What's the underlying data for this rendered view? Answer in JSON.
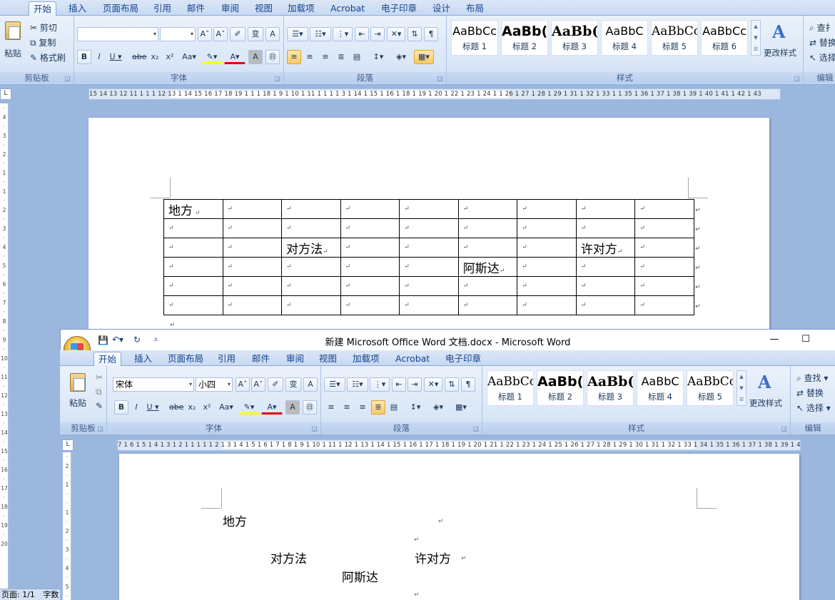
{
  "back_window": {
    "tabs": [
      "开始",
      "插入",
      "页面布局",
      "引用",
      "邮件",
      "审阅",
      "视图",
      "加载项",
      "Acrobat",
      "电子印章",
      "设计",
      "布局"
    ],
    "clipboard": {
      "paste": "粘贴",
      "cut": "剪切",
      "copy": "复制",
      "format_painter": "格式刷",
      "label": "剪贴板"
    },
    "font_label": "字体",
    "paragraph_label": "段落",
    "styles": [
      {
        "sample": "AaBbCc",
        "name": "标题 1"
      },
      {
        "sample": "AaBb(",
        "name": "标题 2"
      },
      {
        "sample": "AaBb(",
        "name": "标题 3"
      },
      {
        "sample": "AaBbC",
        "name": "标题 4"
      },
      {
        "sample": "AaBbCc",
        "name": "标题 5"
      },
      {
        "sample": "AaBbCc",
        "name": "标题 6"
      }
    ],
    "change_styles": "更改样式",
    "styles_label": "样式",
    "editing": {
      "find": "查扌",
      "replace": "替换",
      "select": "选择",
      "label": "编辑"
    },
    "ruler_text": "15 14 13 12 11 1 1 1 12 13 1 14 15 16 17 18 19 1 1 1 18 1 9 1 10 1 11 1 1 1 1 3 1 14 1 15 1 16 1 18 1 19 1 20 1 22 1 23 1 24 1 1 26 1 27 1 28 1 29 1 31 1 32 1 33 1 1 35 1 36 1 37 1 38 1 39 1 40 1 41 1 42 1 43",
    "table": [
      [
        "地方",
        "",
        "",
        "",
        "",
        "",
        "",
        "",
        ""
      ],
      [
        "",
        "",
        "",
        "",
        "",
        "",
        "",
        "",
        ""
      ],
      [
        "",
        "",
        "对方法",
        "",
        "",
        "",
        "",
        "许对方",
        ""
      ],
      [
        "",
        "",
        "",
        "",
        "",
        "阿斯达",
        "",
        "",
        ""
      ],
      [
        "",
        "",
        "",
        "",
        "",
        "",
        "",
        "",
        ""
      ],
      [
        "",
        "",
        "",
        "",
        "",
        "",
        "",
        "",
        ""
      ]
    ],
    "para_mark": "↵"
  },
  "front_window": {
    "title": "新建 Microsoft Office Word 文档.docx - Microsoft Word",
    "tabs": [
      "开始",
      "插入",
      "页面布局",
      "引用",
      "邮件",
      "审阅",
      "视图",
      "加载项",
      "Acrobat",
      "电子印章"
    ],
    "clipboard": {
      "paste": "粘贴",
      "label": "剪贴板"
    },
    "font_name": "宋体",
    "font_size": "小四",
    "font_label": "字体",
    "paragraph_label": "段落",
    "styles": [
      {
        "sample": "AaBbCc",
        "name": "标题 1"
      },
      {
        "sample": "AaBb(",
        "name": "标题 2"
      },
      {
        "sample": "AaBb(",
        "name": "标题 3"
      },
      {
        "sample": "AaBbC",
        "name": "标题 4"
      },
      {
        "sample": "AaBbCc",
        "name": "标题 5"
      }
    ],
    "change_styles": "更改样式",
    "styles_label": "样式",
    "editing": {
      "find": "查找",
      "replace": "替换",
      "select": "选择",
      "label": "编辑"
    },
    "ruler_text": "7 1 6 1 5 1 4 1 3 1 2 1 1 1 1 1 2 1 3 1 4 1 5 1 6 1 7 1 8 1 9 1 10 1 11 1 12 1 13 1 14 1 15 1 16 1 17 1 18 1 19 1 20 1 21 1 22 1 23 1 24 1 25 1 26 1 27 1 28 1 29 1 30 1 31 1 32 1 33 1 34 1 35 1 36 1 37 1 38 1 39 1 40 1 41 1 42",
    "body": {
      "line1": "地方",
      "line2a": "对方法",
      "line2b": "许对方",
      "line3": "阿斯达"
    },
    "para_mark": "↵"
  },
  "status_bar": {
    "page": "页面: 1/1",
    "words": "字数"
  },
  "colors": {
    "ribbon": "#dbe7f7",
    "workspace": "#9bb7de",
    "tab_text": "#15428b"
  }
}
